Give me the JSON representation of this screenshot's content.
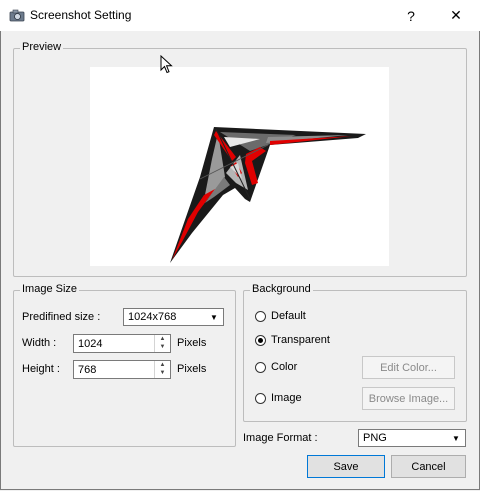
{
  "window": {
    "title": "Screenshot Setting",
    "help_label": "?",
    "close_label": "✕"
  },
  "preview": {
    "legend": "Preview"
  },
  "image_size": {
    "legend": "Image Size",
    "predefined_label": "Predifined size :",
    "predefined_value": "1024x768",
    "width_label": "Width :",
    "width_value": "1024",
    "width_unit": "Pixels",
    "height_label": "Height :",
    "height_value": "768",
    "height_unit": "Pixels"
  },
  "background": {
    "legend": "Background",
    "options": [
      {
        "label": "Default",
        "selected": false
      },
      {
        "label": "Transparent",
        "selected": true
      },
      {
        "label": "Color",
        "selected": false
      },
      {
        "label": "Image",
        "selected": false
      }
    ],
    "edit_color_label": "Edit Color...",
    "browse_image_label": "Browse Image..."
  },
  "image_format": {
    "label": "Image Format :",
    "value": "PNG"
  },
  "buttons": {
    "save_label": "Save",
    "cancel_label": "Cancel"
  }
}
